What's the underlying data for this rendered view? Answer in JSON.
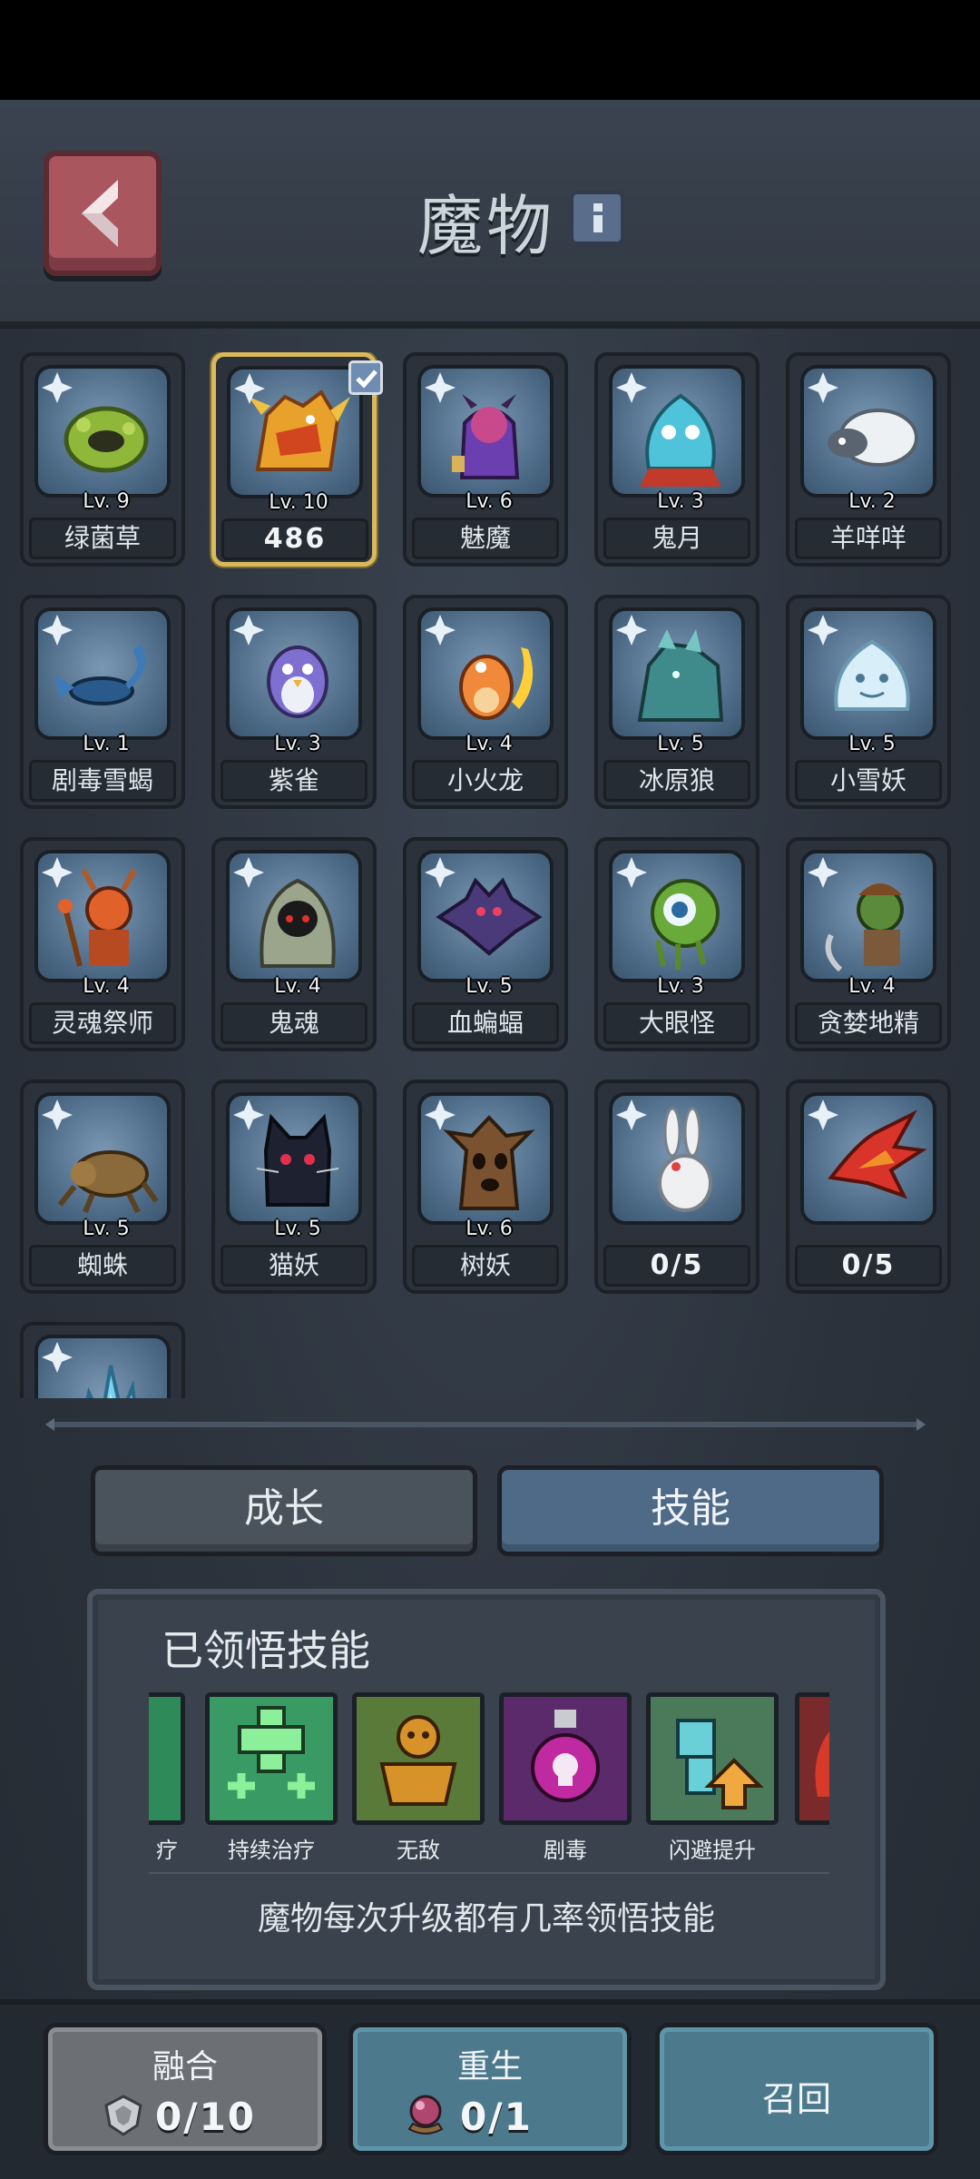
{
  "header": {
    "title": "魔物"
  },
  "monsters": [
    {
      "level": "Lv. 9",
      "name": "绿菌草",
      "art": "green-moss"
    },
    {
      "level": "Lv. 10",
      "name": "486",
      "art": "gold-dragon",
      "selected": true
    },
    {
      "level": "Lv. 6",
      "name": "魅魔",
      "art": "succubus"
    },
    {
      "level": "Lv. 3",
      "name": "鬼月",
      "art": "ghost-flame"
    },
    {
      "level": "Lv. 2",
      "name": "羊咩咩",
      "art": "sheep"
    },
    {
      "level": "Lv. 1",
      "name": "剧毒雪蝎",
      "art": "scorpion"
    },
    {
      "level": "Lv. 3",
      "name": "紫雀",
      "art": "purple-bird"
    },
    {
      "level": "Lv. 4",
      "name": "小火龙",
      "art": "fire-lizard"
    },
    {
      "level": "Lv. 5",
      "name": "冰原狼",
      "art": "ice-wolf"
    },
    {
      "level": "Lv. 5",
      "name": "小雪妖",
      "art": "snow-spirit"
    },
    {
      "level": "Lv. 4",
      "name": "灵魂祭师",
      "art": "soul-priest"
    },
    {
      "level": "Lv. 4",
      "name": "鬼魂",
      "art": "hooded-ghost"
    },
    {
      "level": "Lv. 5",
      "name": "血蝙蝠",
      "art": "bat"
    },
    {
      "level": "Lv. 3",
      "name": "大眼怪",
      "art": "eyeball"
    },
    {
      "level": "Lv. 4",
      "name": "贪婪地精",
      "art": "goblin"
    },
    {
      "level": "Lv. 5",
      "name": "蜘蛛",
      "art": "spider"
    },
    {
      "level": "Lv. 5",
      "name": "猫妖",
      "art": "black-cat"
    },
    {
      "level": "Lv. 6",
      "name": "树妖",
      "art": "treant"
    },
    {
      "level": "",
      "name": "0/5",
      "art": "white-rabbit"
    },
    {
      "level": "",
      "name": "0/5",
      "art": "phoenix"
    },
    {
      "level": "",
      "name": "",
      "art": "ice-crystal"
    }
  ],
  "tabs": {
    "growth": "成长",
    "skills": "技能"
  },
  "skills_panel": {
    "title": "已领悟技能",
    "skills": [
      {
        "label": "疗",
        "icon": "heal-icon"
      },
      {
        "label": "持续治疗",
        "icon": "regen-icon"
      },
      {
        "label": "无敌",
        "icon": "invincible-icon"
      },
      {
        "label": "剧毒",
        "icon": "poison-icon"
      },
      {
        "label": "闪避提升",
        "icon": "dodge-up-icon"
      },
      {
        "label": "",
        "icon": "fire-skill-icon"
      }
    ],
    "hint": "魔物每次升级都有几率领悟技能"
  },
  "bottom": {
    "fuse_label": "融合",
    "fuse_count": "0/10",
    "reborn_label": "重生",
    "reborn_count": "0/1",
    "recall_label": "召回"
  }
}
